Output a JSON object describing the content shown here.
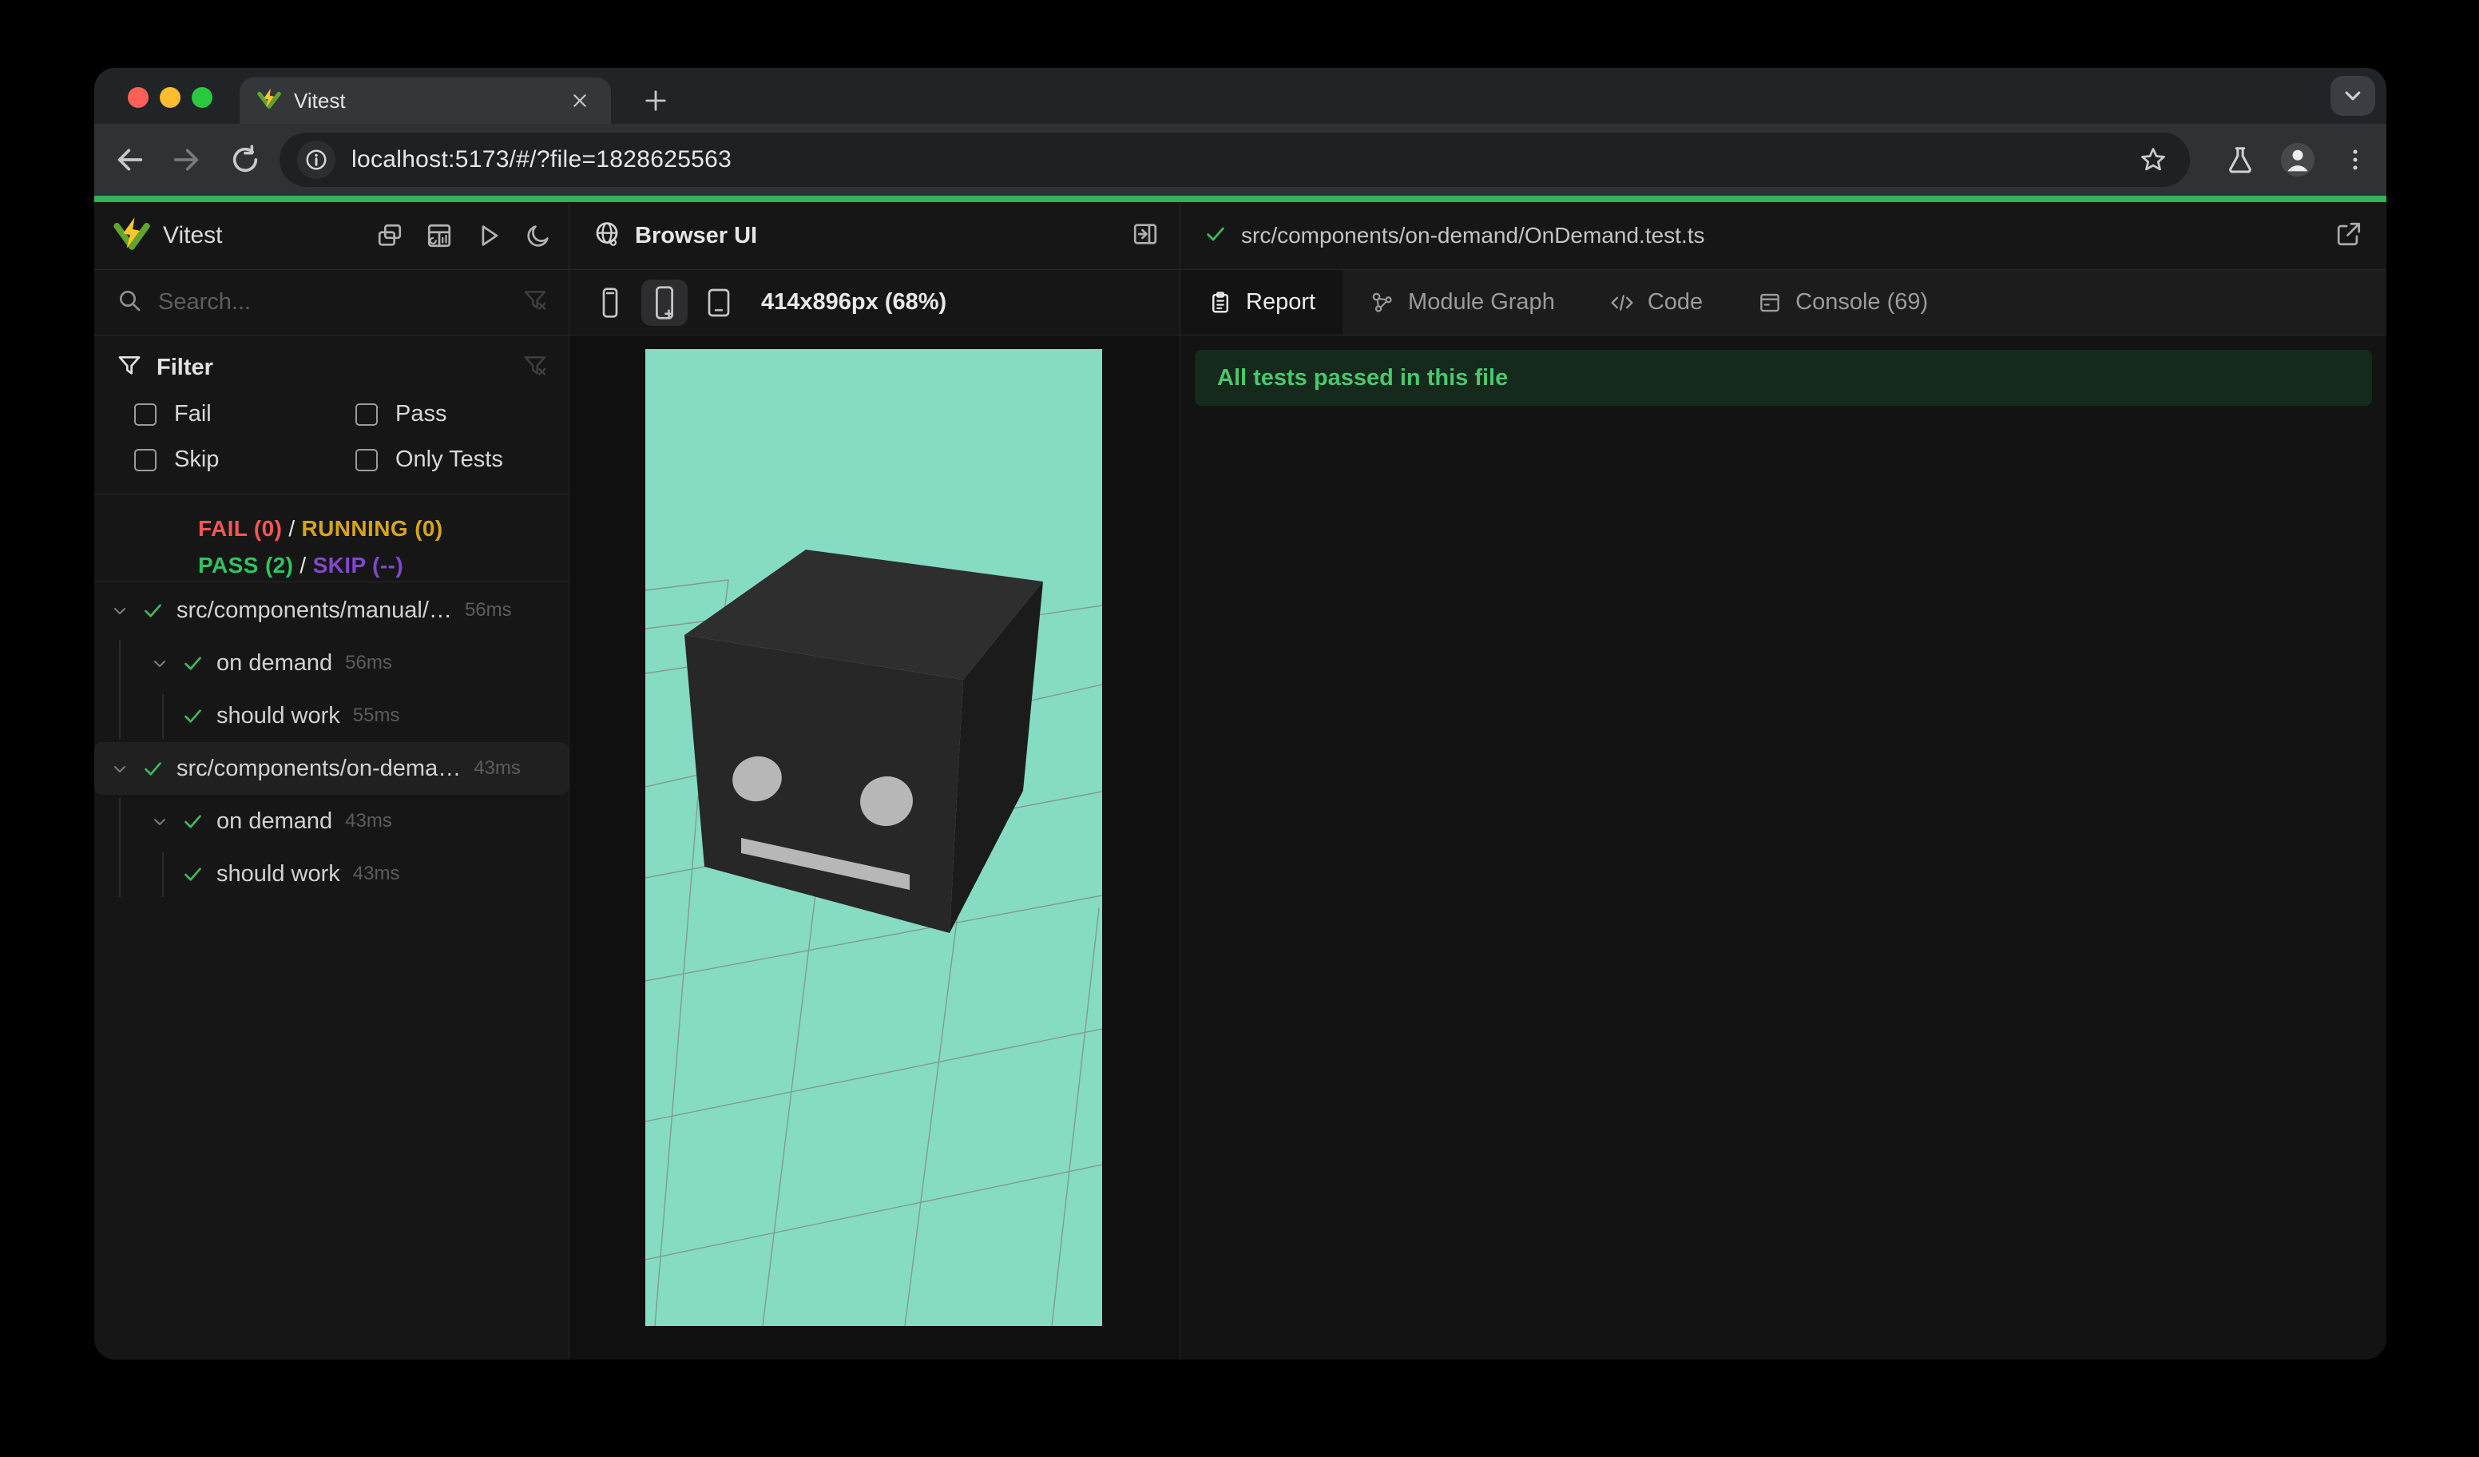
{
  "colors": {
    "accent_green": "#34b255",
    "check_green": "#3cb95a",
    "fail_red": "#f35757",
    "running_yellow": "#d7a51b",
    "pass_green": "#31c35e",
    "skip_purple": "#8347cc",
    "banner_bg": "#15291c",
    "banner_text": "#4bc76c",
    "mint": "#85dcc2"
  },
  "browser": {
    "tab_title": "Vitest",
    "url": "localhost:5173/#/?file=1828625563"
  },
  "sidebar": {
    "app_title": "Vitest",
    "search_placeholder": "Search...",
    "filter": {
      "title": "Filter",
      "options": [
        "Fail",
        "Pass",
        "Skip",
        "Only Tests"
      ]
    },
    "summary": {
      "fail": "FAIL (0)",
      "sep1": "/",
      "running": "RUNNING (0)",
      "pass": "PASS (2)",
      "sep2": "/",
      "skip": "SKIP (--)"
    },
    "tree": [
      {
        "label": "src/components/manual/…",
        "duration": "56ms"
      },
      {
        "label": "on demand",
        "duration": "56ms"
      },
      {
        "label": "should work",
        "duration": "55ms"
      },
      {
        "label": "src/components/on-dema…",
        "duration": "43ms"
      },
      {
        "label": "on demand",
        "duration": "43ms"
      },
      {
        "label": "should work",
        "duration": "43ms"
      }
    ]
  },
  "browser_panel": {
    "title": "Browser UI",
    "viewport_label": "414x896px (68%)"
  },
  "report_panel": {
    "file_path": "src/components/on-demand/OnDemand.test.ts",
    "tabs": [
      {
        "label": "Report"
      },
      {
        "label": "Module Graph"
      },
      {
        "label": "Code"
      },
      {
        "label": "Console (69)"
      }
    ],
    "banner": "All tests passed in this file"
  }
}
